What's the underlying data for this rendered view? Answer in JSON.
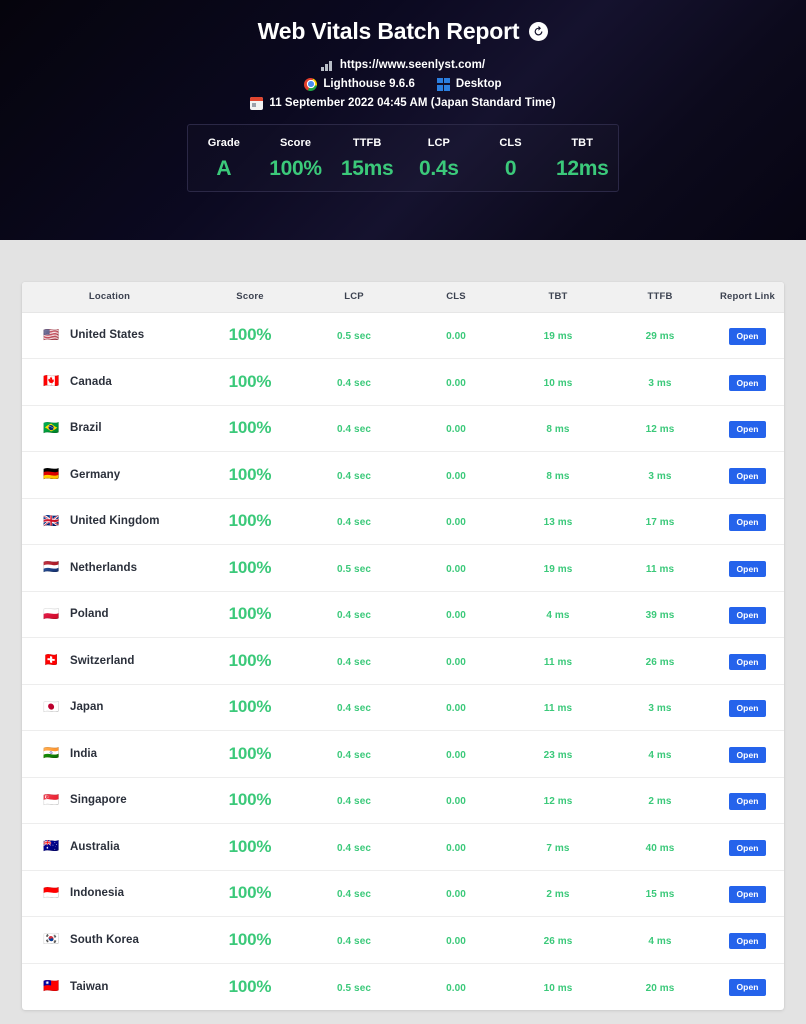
{
  "header": {
    "title": "Web Vitals Batch Report",
    "refresh_icon": "refresh-icon",
    "url": "https://www.seenlyst.com/",
    "url_icon": "analytics-chart-icon",
    "lighthouse": "Lighthouse 9.6.6",
    "lighthouse_icon": "chrome-icon",
    "device": "Desktop",
    "device_icon": "windows-icon",
    "date": "11 September 2022 04:45 AM (Japan Standard Time)",
    "date_icon": "calendar-icon",
    "accent_green": "#3bc97a",
    "background": "#0b0920"
  },
  "summary": [
    {
      "label": "Grade",
      "value": "A"
    },
    {
      "label": "Score",
      "value": "100%"
    },
    {
      "label": "TTFB",
      "value": "15ms"
    },
    {
      "label": "LCP",
      "value": "0.4s"
    },
    {
      "label": "CLS",
      "value": "0"
    },
    {
      "label": "TBT",
      "value": "12ms"
    }
  ],
  "table": {
    "columns": [
      "Location",
      "Score",
      "LCP",
      "CLS",
      "TBT",
      "TTFB",
      "Report Link"
    ],
    "open_label": "Open",
    "open_color": "#2563eb",
    "rows": [
      {
        "flag": "🇺🇸",
        "location": "United States",
        "score": "100%",
        "lcp": "0.5 sec",
        "cls": "0.00",
        "tbt": "19 ms",
        "ttfb": "29 ms",
        "link": "Open"
      },
      {
        "flag": "🇨🇦",
        "location": "Canada",
        "score": "100%",
        "lcp": "0.4 sec",
        "cls": "0.00",
        "tbt": "10 ms",
        "ttfb": "3 ms",
        "link": "Open"
      },
      {
        "flag": "🇧🇷",
        "location": "Brazil",
        "score": "100%",
        "lcp": "0.4 sec",
        "cls": "0.00",
        "tbt": "8 ms",
        "ttfb": "12 ms",
        "link": "Open"
      },
      {
        "flag": "🇩🇪",
        "location": "Germany",
        "score": "100%",
        "lcp": "0.4 sec",
        "cls": "0.00",
        "tbt": "8 ms",
        "ttfb": "3 ms",
        "link": "Open"
      },
      {
        "flag": "🇬🇧",
        "location": "United Kingdom",
        "score": "100%",
        "lcp": "0.4 sec",
        "cls": "0.00",
        "tbt": "13 ms",
        "ttfb": "17 ms",
        "link": "Open"
      },
      {
        "flag": "🇳🇱",
        "location": "Netherlands",
        "score": "100%",
        "lcp": "0.5 sec",
        "cls": "0.00",
        "tbt": "19 ms",
        "ttfb": "11 ms",
        "link": "Open"
      },
      {
        "flag": "🇵🇱",
        "location": "Poland",
        "score": "100%",
        "lcp": "0.4 sec",
        "cls": "0.00",
        "tbt": "4 ms",
        "ttfb": "39 ms",
        "link": "Open"
      },
      {
        "flag": "🇨🇭",
        "location": "Switzerland",
        "score": "100%",
        "lcp": "0.4 sec",
        "cls": "0.00",
        "tbt": "11 ms",
        "ttfb": "26 ms",
        "link": "Open"
      },
      {
        "flag": "🇯🇵",
        "location": "Japan",
        "score": "100%",
        "lcp": "0.4 sec",
        "cls": "0.00",
        "tbt": "11 ms",
        "ttfb": "3 ms",
        "link": "Open"
      },
      {
        "flag": "🇮🇳",
        "location": "India",
        "score": "100%",
        "lcp": "0.4 sec",
        "cls": "0.00",
        "tbt": "23 ms",
        "ttfb": "4 ms",
        "link": "Open"
      },
      {
        "flag": "🇸🇬",
        "location": "Singapore",
        "score": "100%",
        "lcp": "0.4 sec",
        "cls": "0.00",
        "tbt": "12 ms",
        "ttfb": "2 ms",
        "link": "Open"
      },
      {
        "flag": "🇦🇺",
        "location": "Australia",
        "score": "100%",
        "lcp": "0.4 sec",
        "cls": "0.00",
        "tbt": "7 ms",
        "ttfb": "40 ms",
        "link": "Open"
      },
      {
        "flag": "🇮🇩",
        "location": "Indonesia",
        "score": "100%",
        "lcp": "0.4 sec",
        "cls": "0.00",
        "tbt": "2 ms",
        "ttfb": "15 ms",
        "link": "Open"
      },
      {
        "flag": "🇰🇷",
        "location": "South Korea",
        "score": "100%",
        "lcp": "0.4 sec",
        "cls": "0.00",
        "tbt": "26 ms",
        "ttfb": "4 ms",
        "link": "Open"
      },
      {
        "flag": "🇹🇼",
        "location": "Taiwan",
        "score": "100%",
        "lcp": "0.5 sec",
        "cls": "0.00",
        "tbt": "10 ms",
        "ttfb": "20 ms",
        "link": "Open"
      }
    ]
  }
}
